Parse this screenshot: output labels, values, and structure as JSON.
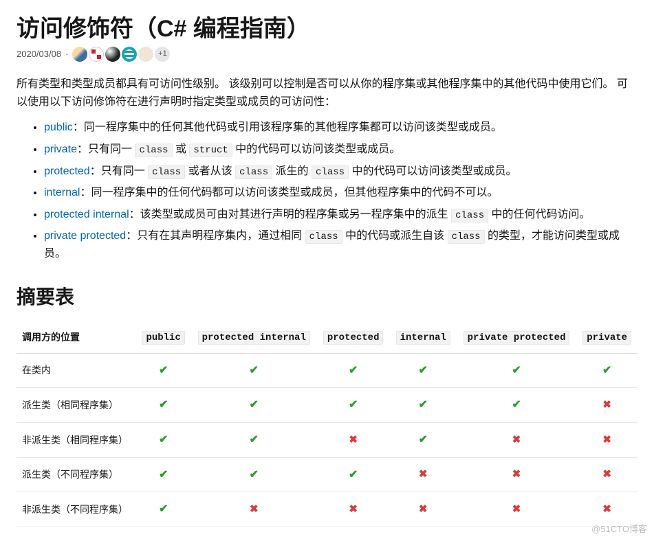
{
  "title": "访问修饰符（C# 编程指南）",
  "date": "2020/03/08",
  "more_contributors": "+1",
  "intro_p1": "所有类型和类型成员都具有可访问性级别。 该级别可以控制是否可以从你的程序集或其他程序集中的其他代码中使用它们。 可以使用以下访问修饰符在进行声明时指定类型或成员的可访问性：",
  "modifiers": [
    {
      "name": "public",
      "text": "：同一程序集中的任何其他代码或引用该程序集的其他程序集都可以访问该类型或成员。"
    },
    {
      "name": "private",
      "text_parts": [
        "：只有同一 ",
        "class",
        " 或 ",
        "struct",
        " 中的代码可以访问该类型或成员。"
      ]
    },
    {
      "name": "protected",
      "text_parts": [
        "：只有同一 ",
        "class",
        " 或者从该 ",
        "class",
        " 派生的 ",
        "class",
        " 中的代码可以访问该类型或成员。"
      ]
    },
    {
      "name": "internal",
      "text": "：同一程序集中的任何代码都可以访问该类型或成员，但其他程序集中的代码不可以。"
    },
    {
      "name": "protected internal",
      "text_parts": [
        "：该类型或成员可由对其进行声明的程序集或另一程序集中的派生 ",
        "class",
        " 中的任何代码访问。"
      ]
    },
    {
      "name": "private protected",
      "text_parts": [
        "：只有在其声明程序集内，通过相同 ",
        "class",
        " 中的代码或派生自该 ",
        "class",
        " 的类型，才能访问类型或成员。"
      ]
    }
  ],
  "summary_heading": "摘要表",
  "table": {
    "row_header": "调用方的位置",
    "cols": [
      "public",
      "protected internal",
      "protected",
      "internal",
      "private protected",
      "private"
    ],
    "rows": [
      {
        "label": "在类内",
        "cells": [
          true,
          true,
          true,
          true,
          true,
          true
        ]
      },
      {
        "label": "派生类（相同程序集）",
        "cells": [
          true,
          true,
          true,
          true,
          true,
          false
        ]
      },
      {
        "label": "非派生类（相同程序集）",
        "cells": [
          true,
          true,
          false,
          true,
          false,
          false
        ]
      },
      {
        "label": "派生类（不同程序集）",
        "cells": [
          true,
          true,
          true,
          false,
          false,
          false
        ]
      },
      {
        "label": "非派生类（不同程序集）",
        "cells": [
          true,
          false,
          false,
          false,
          false,
          false
        ]
      }
    ]
  },
  "watermark": "@51CTO博客"
}
